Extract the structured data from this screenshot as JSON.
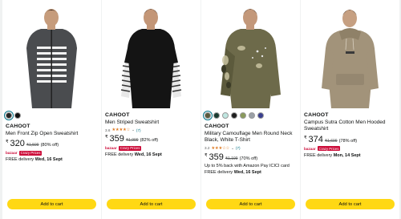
{
  "products": [
    {
      "brand": "CAHOOT",
      "title": "Men Front Zip Open Sweatshirt",
      "rating": "",
      "rating_count": "",
      "price_symbol": "₹",
      "price": "320",
      "mrp": "₹1,599",
      "discount": "(80% off)",
      "bazaar": "bazaar",
      "crazy": "Crazy Prices",
      "delivery_prefix": "FREE delivery",
      "delivery_date": "Wed, 16 Sept",
      "extra": "",
      "cart_label": "Add to cart",
      "swatches": [
        "#222222",
        "#111111"
      ]
    },
    {
      "brand": "CAHOOT",
      "title": "Men Striped Sweatshirt",
      "rating": "3.6",
      "rating_count": "(7)",
      "stars_value": 3.6,
      "price_symbol": "₹",
      "price": "359",
      "mrp": "₹1,999",
      "discount": "(82% off)",
      "bazaar": "bazaar",
      "crazy": "Crazy Prices",
      "delivery_prefix": "FREE delivery",
      "delivery_date": "Wed, 16 Sept",
      "extra": "",
      "cart_label": "Add to cart",
      "swatches": []
    },
    {
      "brand": "CAHOOT",
      "title": "Military Camouflage Men Round Neck Black, White T-Shirt",
      "rating": "3.2",
      "rating_count": "(7)",
      "stars_value": 3.2,
      "price_symbol": "₹",
      "price": "359",
      "mrp": "₹1,199",
      "discount": "(70% off)",
      "bazaar": "",
      "crazy": "",
      "delivery_prefix": "FREE delivery",
      "delivery_date": "Wed, 16 Sept",
      "extra": "Up to 5% back with Amazon Pay ICICI card",
      "cart_label": "Add to cart",
      "swatches": [
        "#5a5a3c",
        "#1a3b30",
        "#bfe6e0",
        "#1e1e1e",
        "#8a9a5b",
        "#9aa0a6",
        "#3a3f8f"
      ]
    },
    {
      "brand": "CAHOOT",
      "title": "Campus Sutra Cotton Men Hooded Sweatshirt",
      "rating": "",
      "rating_count": "",
      "price_symbol": "₹",
      "price": "374",
      "mrp": "₹1,699",
      "discount": "(78% off)",
      "bazaar": "bazaar",
      "crazy": "Crazy Prices",
      "delivery_prefix": "FREE delivery",
      "delivery_date": "Mon, 14 Sept",
      "extra": "",
      "cart_label": "Add to cart",
      "swatches": []
    }
  ],
  "colors": {
    "cart_button": "#ffd814",
    "deal_red": "#cc0c39",
    "star": "#de7921",
    "link": "#007185"
  }
}
